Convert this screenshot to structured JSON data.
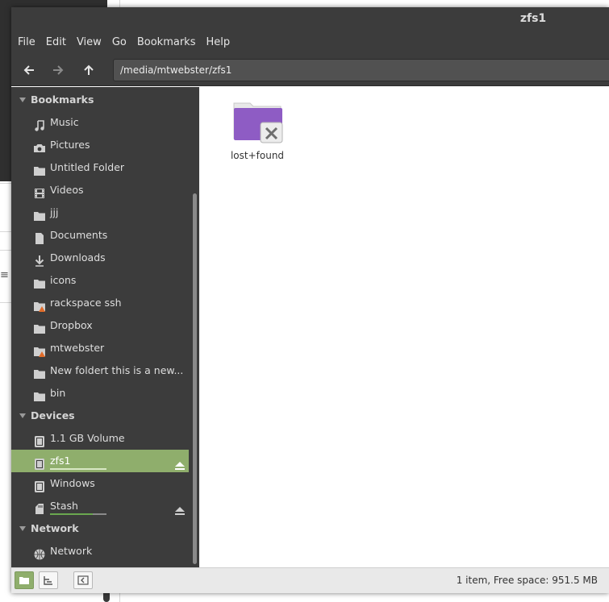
{
  "window": {
    "title": "zfs1"
  },
  "menu": [
    {
      "label": "File"
    },
    {
      "label": "Edit"
    },
    {
      "label": "View"
    },
    {
      "label": "Go"
    },
    {
      "label": "Bookmarks"
    },
    {
      "label": "Help"
    }
  ],
  "toolbar": {
    "location": "/media/mtwebster/zfs1"
  },
  "sidebar": {
    "bookmarks_header": "Bookmarks",
    "bookmarks": [
      {
        "label": "Music",
        "icon": "music-icon"
      },
      {
        "label": "Pictures",
        "icon": "camera-icon"
      },
      {
        "label": "Untitled Folder",
        "icon": "folder-icon"
      },
      {
        "label": "Videos",
        "icon": "film-icon"
      },
      {
        "label": "jjj",
        "icon": "folder-icon"
      },
      {
        "label": "Documents",
        "icon": "document-icon"
      },
      {
        "label": "Downloads",
        "icon": "download-icon"
      },
      {
        "label": "icons",
        "icon": "folder-icon"
      },
      {
        "label": "rackspace ssh",
        "icon": "folder-warning-icon"
      },
      {
        "label": "Dropbox",
        "icon": "folder-icon"
      },
      {
        "label": "mtwebster",
        "icon": "folder-warning-icon"
      },
      {
        "label": "New foldert this is a new...",
        "icon": "folder-icon"
      },
      {
        "label": "bin",
        "icon": "folder-icon"
      }
    ],
    "devices_header": "Devices",
    "devices": [
      {
        "label": "1.1 GB Volume",
        "icon": "drive-icon"
      },
      {
        "label": "zfs1",
        "icon": "drive-icon",
        "selected": true,
        "usage": 1.0
      },
      {
        "label": "Windows",
        "icon": "drive-icon"
      },
      {
        "label": "Stash",
        "icon": "sdcard-icon",
        "usage": 0.75
      }
    ],
    "network_header": "Network",
    "network": [
      {
        "label": "Network",
        "icon": "network-icon"
      }
    ]
  },
  "files": [
    {
      "name": "lost+found",
      "icon": "folder-locked-icon"
    }
  ],
  "status": {
    "text": "1 item, Free space: 951.5 MB"
  },
  "colors": {
    "accent": "#8fae6c",
    "sidebar_bg": "#3c3c3c",
    "folder": "#8e5cc4"
  }
}
